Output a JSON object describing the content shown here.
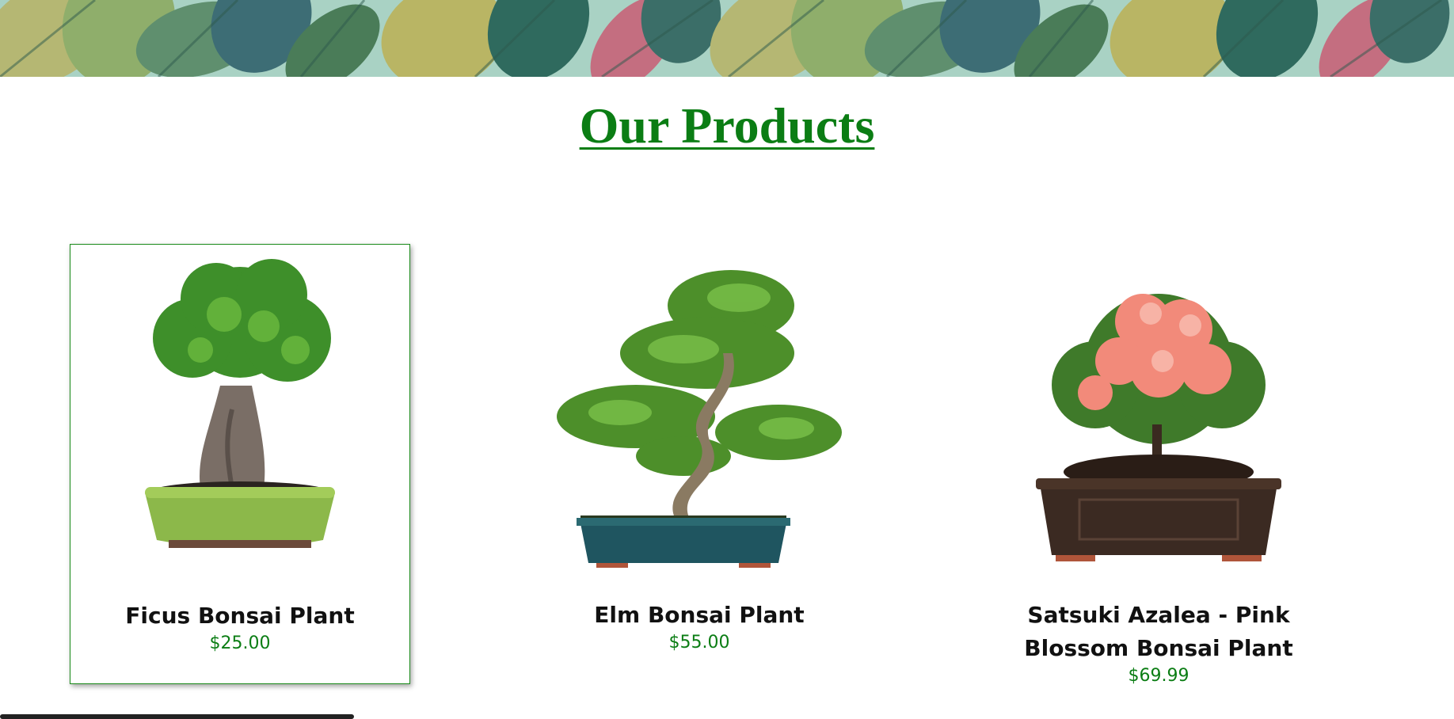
{
  "page": {
    "heading": "Our Products",
    "accent_color": "#0b7d14"
  },
  "banner": {
    "icon": "tropical-leaves-pattern"
  },
  "products": [
    {
      "name": "Ficus Bonsai Plant",
      "price": "$25.00",
      "image": "ficus-bonsai-image",
      "pot_color": "#8cb84a",
      "selected": true
    },
    {
      "name": "Elm Bonsai Plant",
      "price": "$55.00",
      "image": "elm-bonsai-image",
      "pot_color": "#1f5560",
      "selected": false
    },
    {
      "name": "Satsuki Azalea - Pink Blossom Bonsai Plant",
      "price": "$69.99",
      "image": "azalea-bonsai-image",
      "pot_color": "#3b2a22",
      "selected": false
    }
  ]
}
